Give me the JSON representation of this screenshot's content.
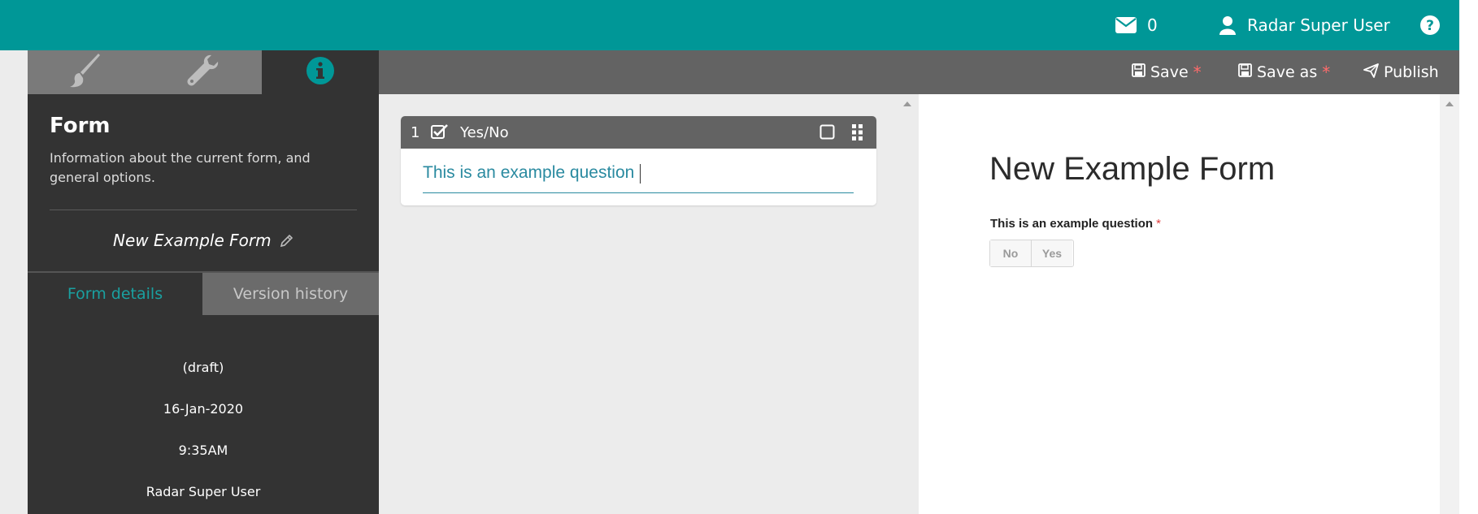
{
  "topbar": {
    "messages_count": "0",
    "user_name": "Radar Super User",
    "help_icon": "question-circle-icon",
    "colors": {
      "bg": "#009797"
    }
  },
  "toolbar": {
    "save_label": "Save",
    "save_as_label": "Save as",
    "publish_label": "Publish",
    "unsaved_marker": "*"
  },
  "sidebar": {
    "tabs": [
      {
        "icon": "paintbrush-icon"
      },
      {
        "icon": "wrench-icon"
      },
      {
        "icon": "info-circle-icon"
      }
    ],
    "title": "Form",
    "description": "Information about the current form, and general options.",
    "form_name": "New Example Form",
    "subtabs": {
      "form_details": "Form details",
      "version_history": "Version history"
    },
    "version": {
      "status": "(draft)",
      "date": "16-Jan-2020",
      "time": "9:35AM",
      "author": "Radar Super User"
    }
  },
  "editor": {
    "question": {
      "number": "1",
      "type_label": "Yes/No",
      "text": "This is an example question"
    }
  },
  "preview": {
    "title": "New Example Form",
    "question_label": "This is an example question",
    "required_marker": "*",
    "options": [
      "No",
      "Yes"
    ]
  }
}
